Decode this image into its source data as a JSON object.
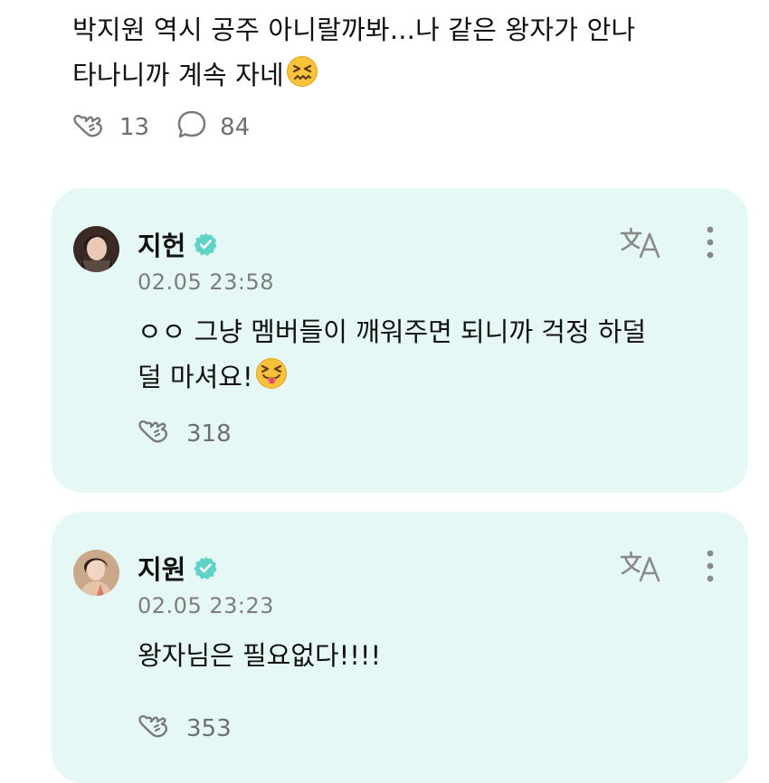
{
  "post": {
    "text_line1": "박지원 역시 공주 아니랄까봐...나 같은 왕자가 안나",
    "text_line2": "타나니까 계속 자네",
    "text_emoji": "confounded-face-emoji",
    "like_count": "13",
    "comment_count": "84"
  },
  "comments": [
    {
      "author": "지헌",
      "verified": true,
      "timestamp": "02.05 23:58",
      "text_line1": "ㅇㅇ 그냥 멤버들이 깨워주면 되니까 걱정 하덜",
      "text_line2": "덜 마셔요!",
      "text_emoji": "squinting-tongue-face-emoji",
      "like_count": "318"
    },
    {
      "author": "지원",
      "verified": true,
      "timestamp": "02.05 23:23",
      "text": "왕자님은 필요없다!!!!",
      "like_count": "353"
    }
  ],
  "icons": {
    "like": "heart-fist-outline-icon",
    "comment": "speech-bubble-icon",
    "translate": "translate-icon",
    "more": "more-vertical-icon",
    "verified": "verified-badge-icon"
  },
  "colors": {
    "card_background": "#e6f8f6",
    "verified_badge": "#5fd3c6",
    "meta_text": "#7d7d7d",
    "count_text": "#6f6f6f"
  }
}
